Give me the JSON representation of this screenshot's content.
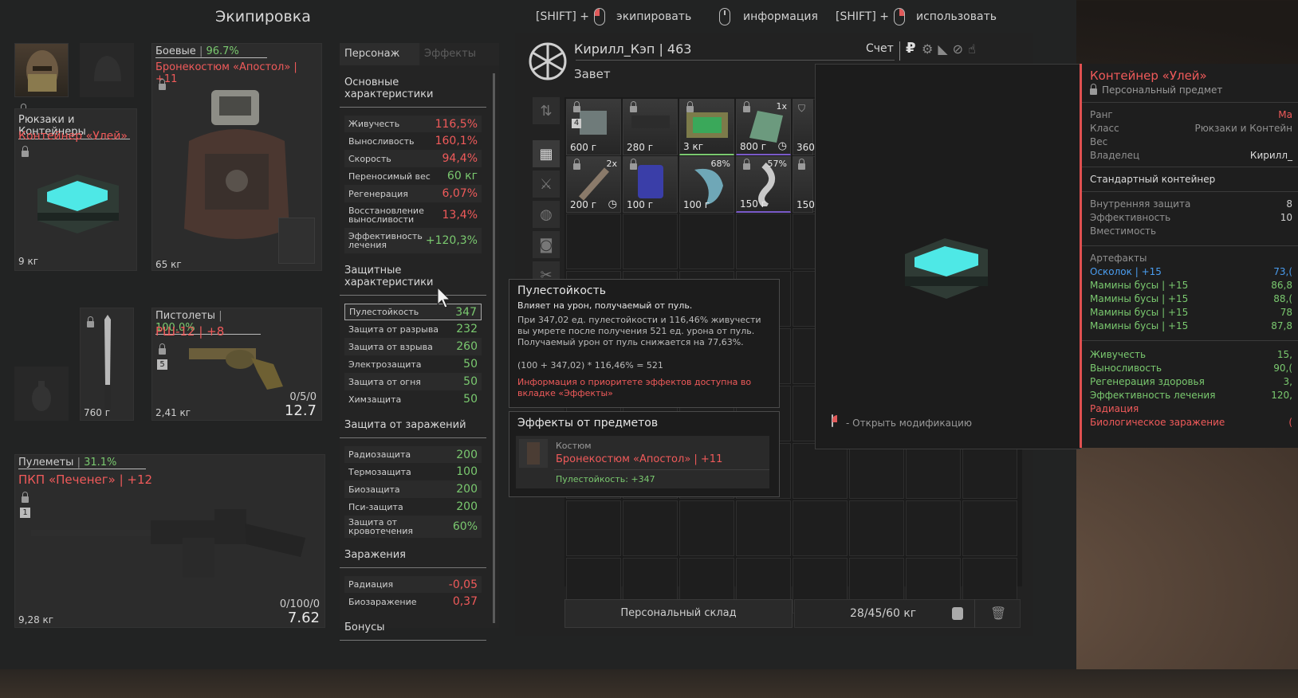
{
  "header": {
    "title": "Экипировка",
    "hints": [
      {
        "prefix": "[SHIFT] +",
        "label": "экипировать"
      },
      {
        "prefix": "",
        "label": "информация"
      },
      {
        "prefix": "[SHIFT] +",
        "label": "использовать"
      }
    ]
  },
  "equipment": {
    "backpack": {
      "category": "Рюкзаки и Контейнеры",
      "name": "Контейнер «Улей»",
      "weight": "9 кг"
    },
    "armor": {
      "category": "Боевые",
      "percent": "96.7%",
      "name": "Бронекостюм «Апостол» | +11",
      "weight": "65 кг"
    },
    "melee": {
      "price": "760 г"
    },
    "pistol": {
      "category": "Пистолеты",
      "percent": "100.0%",
      "name": "РШ-12 | +8",
      "slot_num": "5",
      "ammo": "0/5/0",
      "caliber": "12.7",
      "weight": "2,41 кг"
    },
    "machinegun": {
      "category": "Пулеметы",
      "percent": "31.1%",
      "name": "ПКП «Печенег» | +12",
      "slot_num": "1",
      "ammo": "0/100/0",
      "caliber": "7.62",
      "weight": "9,28 кг"
    }
  },
  "stats": {
    "tabs": [
      "Персонаж",
      "Эффекты"
    ],
    "main_title": "Основные характеристики",
    "main": [
      {
        "name": "Живучесть",
        "value": "116,5%"
      },
      {
        "name": "Выносливость",
        "value": "160,1%"
      },
      {
        "name": "Скорость",
        "value": "94,4%"
      },
      {
        "name": "Переносимый вес",
        "value": "60 кг"
      },
      {
        "name": "Регенерация",
        "value": "6,07%"
      },
      {
        "name": "Восстановление выносливости",
        "value": "13,4%"
      },
      {
        "name": "Эффективность лечения",
        "value": "+120,3%"
      }
    ],
    "prot_title": "Защитные характеристики",
    "prot": [
      {
        "name": "Пулестойкость",
        "value": "347"
      },
      {
        "name": "Защита от разрыва",
        "value": "232"
      },
      {
        "name": "Защита от взрыва",
        "value": "260"
      },
      {
        "name": "Электрозащита",
        "value": "50"
      },
      {
        "name": "Защита от огня",
        "value": "50"
      },
      {
        "name": "Химзащита",
        "value": "50"
      }
    ],
    "inf_title": "Защита от заражений",
    "inf": [
      {
        "name": "Радиозащита",
        "value": "200"
      },
      {
        "name": "Термозащита",
        "value": "100"
      },
      {
        "name": "Биозащита",
        "value": "200"
      },
      {
        "name": "Пси-защита",
        "value": "200"
      },
      {
        "name": "Защита от кровотечения",
        "value": "60%"
      }
    ],
    "cont_title": "Заражения",
    "cont": [
      {
        "name": "Радиация",
        "value": "-0,05"
      },
      {
        "name": "Биозаражение",
        "value": "0,37"
      }
    ],
    "bonus_title": "Бонусы"
  },
  "player": {
    "name": "Кирилл_Кэп | 463",
    "faction": "Завет",
    "account": "Счет"
  },
  "inventory": {
    "items": [
      {
        "price": "600 г",
        "badge": "4",
        "extra": ""
      },
      {
        "price": "280 г",
        "badge": "",
        "extra": ""
      },
      {
        "price": "3 кг",
        "badge": "",
        "extra": ""
      },
      {
        "price": "800 г",
        "badge": "",
        "extra": "1x"
      },
      {
        "price": "360",
        "badge": "",
        "extra": ""
      },
      {
        "price": "200 г",
        "badge": "",
        "extra": "2x"
      },
      {
        "price": "100 г",
        "badge": "",
        "extra": ""
      },
      {
        "price": "100 г",
        "badge": "",
        "extra": "68%"
      },
      {
        "price": "150 г",
        "badge": "",
        "extra": "57%"
      },
      {
        "price": "150",
        "badge": "",
        "extra": ""
      }
    ],
    "footer_label": "Персональный склад",
    "footer_weight": "28/45/60 кг"
  },
  "tooltip": {
    "title": "Пулестойкость",
    "subtitle": "Влияет на урон, получаемый от пуль.",
    "body": "При 347,02 ед. пулестойкости и 116,46% живучести вы умрете после получения 521 ед. урона от пуль. Получаемый урон от пуль снижается на 77,63%.",
    "formula": "(100 + 347,02) * 116,46% = 521",
    "note": "Информация о приоритете эффектов доступна во вкладке «Эффекты»",
    "effects_title": "Эффекты от предметов",
    "effect_category": "Костюм",
    "effect_item": "Бронекостюм «Апостол» | +11",
    "effect_value": "Пулестойкость: +347"
  },
  "preview": {
    "hint": "- Открыть модификацию"
  },
  "info": {
    "title": "Контейнер «Улей»",
    "subtitle": "Персональный предмет",
    "props": [
      {
        "k": "Ранг",
        "v": "Ма"
      },
      {
        "k": "Класс",
        "v": "Рюкзаки и Контейн"
      },
      {
        "k": "Вес",
        "v": ""
      },
      {
        "k": "Владелец",
        "v": "Кирилл_"
      }
    ],
    "desc": "Стандартный контейнер",
    "props2": [
      {
        "k": "Внутренняя защита",
        "v": "8"
      },
      {
        "k": "Эффективность",
        "v": "10"
      },
      {
        "k": "Вместимость",
        "v": ""
      }
    ],
    "art_title": "Артефакты",
    "arts": [
      {
        "k": "Осколок | +15",
        "v": "73,("
      },
      {
        "k": "Мамины бусы | +15",
        "v": "86,8"
      },
      {
        "k": "Мамины бусы | +15",
        "v": "88,("
      },
      {
        "k": "Мамины бусы | +15",
        "v": "78"
      },
      {
        "k": "Мамины бусы | +15",
        "v": "87,8"
      }
    ],
    "effects": [
      {
        "k": "Живучесть",
        "v": "15,"
      },
      {
        "k": "Выносливость",
        "v": "90,("
      },
      {
        "k": "Регенерация здоровья",
        "v": "3,"
      },
      {
        "k": "Эффективность лечения",
        "v": "120,"
      },
      {
        "k": "Радиация",
        "v": ""
      },
      {
        "k": "Биологическое заражение",
        "v": "("
      }
    ]
  },
  "colors": {
    "accent_red": "#f05a5a",
    "accent_green": "#7ac96f",
    "link_blue": "#4a9df0"
  }
}
